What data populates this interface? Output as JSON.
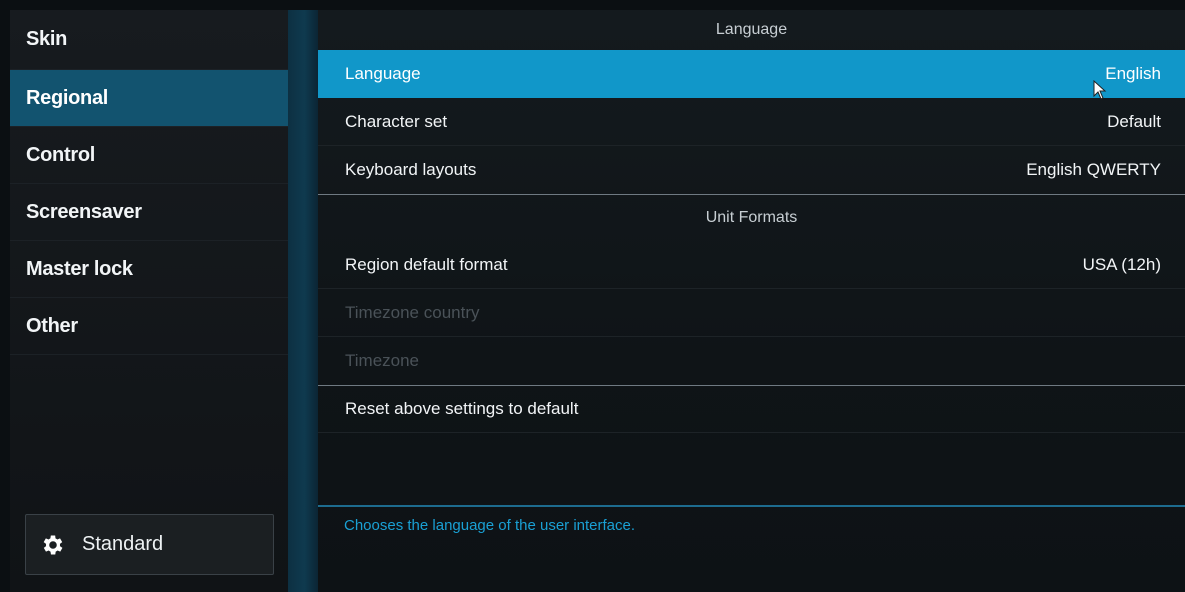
{
  "sidebar": {
    "items": [
      {
        "label": "Skin",
        "active": false
      },
      {
        "label": "Regional",
        "active": true
      },
      {
        "label": "Control",
        "active": false
      },
      {
        "label": "Screensaver",
        "active": false
      },
      {
        "label": "Master lock",
        "active": false
      },
      {
        "label": "Other",
        "active": false
      }
    ],
    "level_button": {
      "label": "Standard",
      "icon": "gear-icon"
    }
  },
  "main": {
    "language_section": {
      "header": "Language",
      "rows": [
        {
          "label": "Language",
          "value": "English",
          "selected": true
        },
        {
          "label": "Character set",
          "value": "Default"
        },
        {
          "label": "Keyboard layouts",
          "value": "English QWERTY"
        }
      ]
    },
    "unit_section": {
      "header": "Unit Formats",
      "rows": [
        {
          "label": "Region default format",
          "value": "USA (12h)"
        },
        {
          "label": "Timezone country",
          "value": "",
          "disabled": true
        },
        {
          "label": "Timezone",
          "value": "",
          "disabled": true
        }
      ]
    },
    "reset_label": "Reset above settings to default",
    "description": "Chooses the language of the user interface."
  },
  "colors": {
    "accent": "#1197c9",
    "sidebar_active": "#12536f",
    "description_text": "#1aa0d4"
  }
}
